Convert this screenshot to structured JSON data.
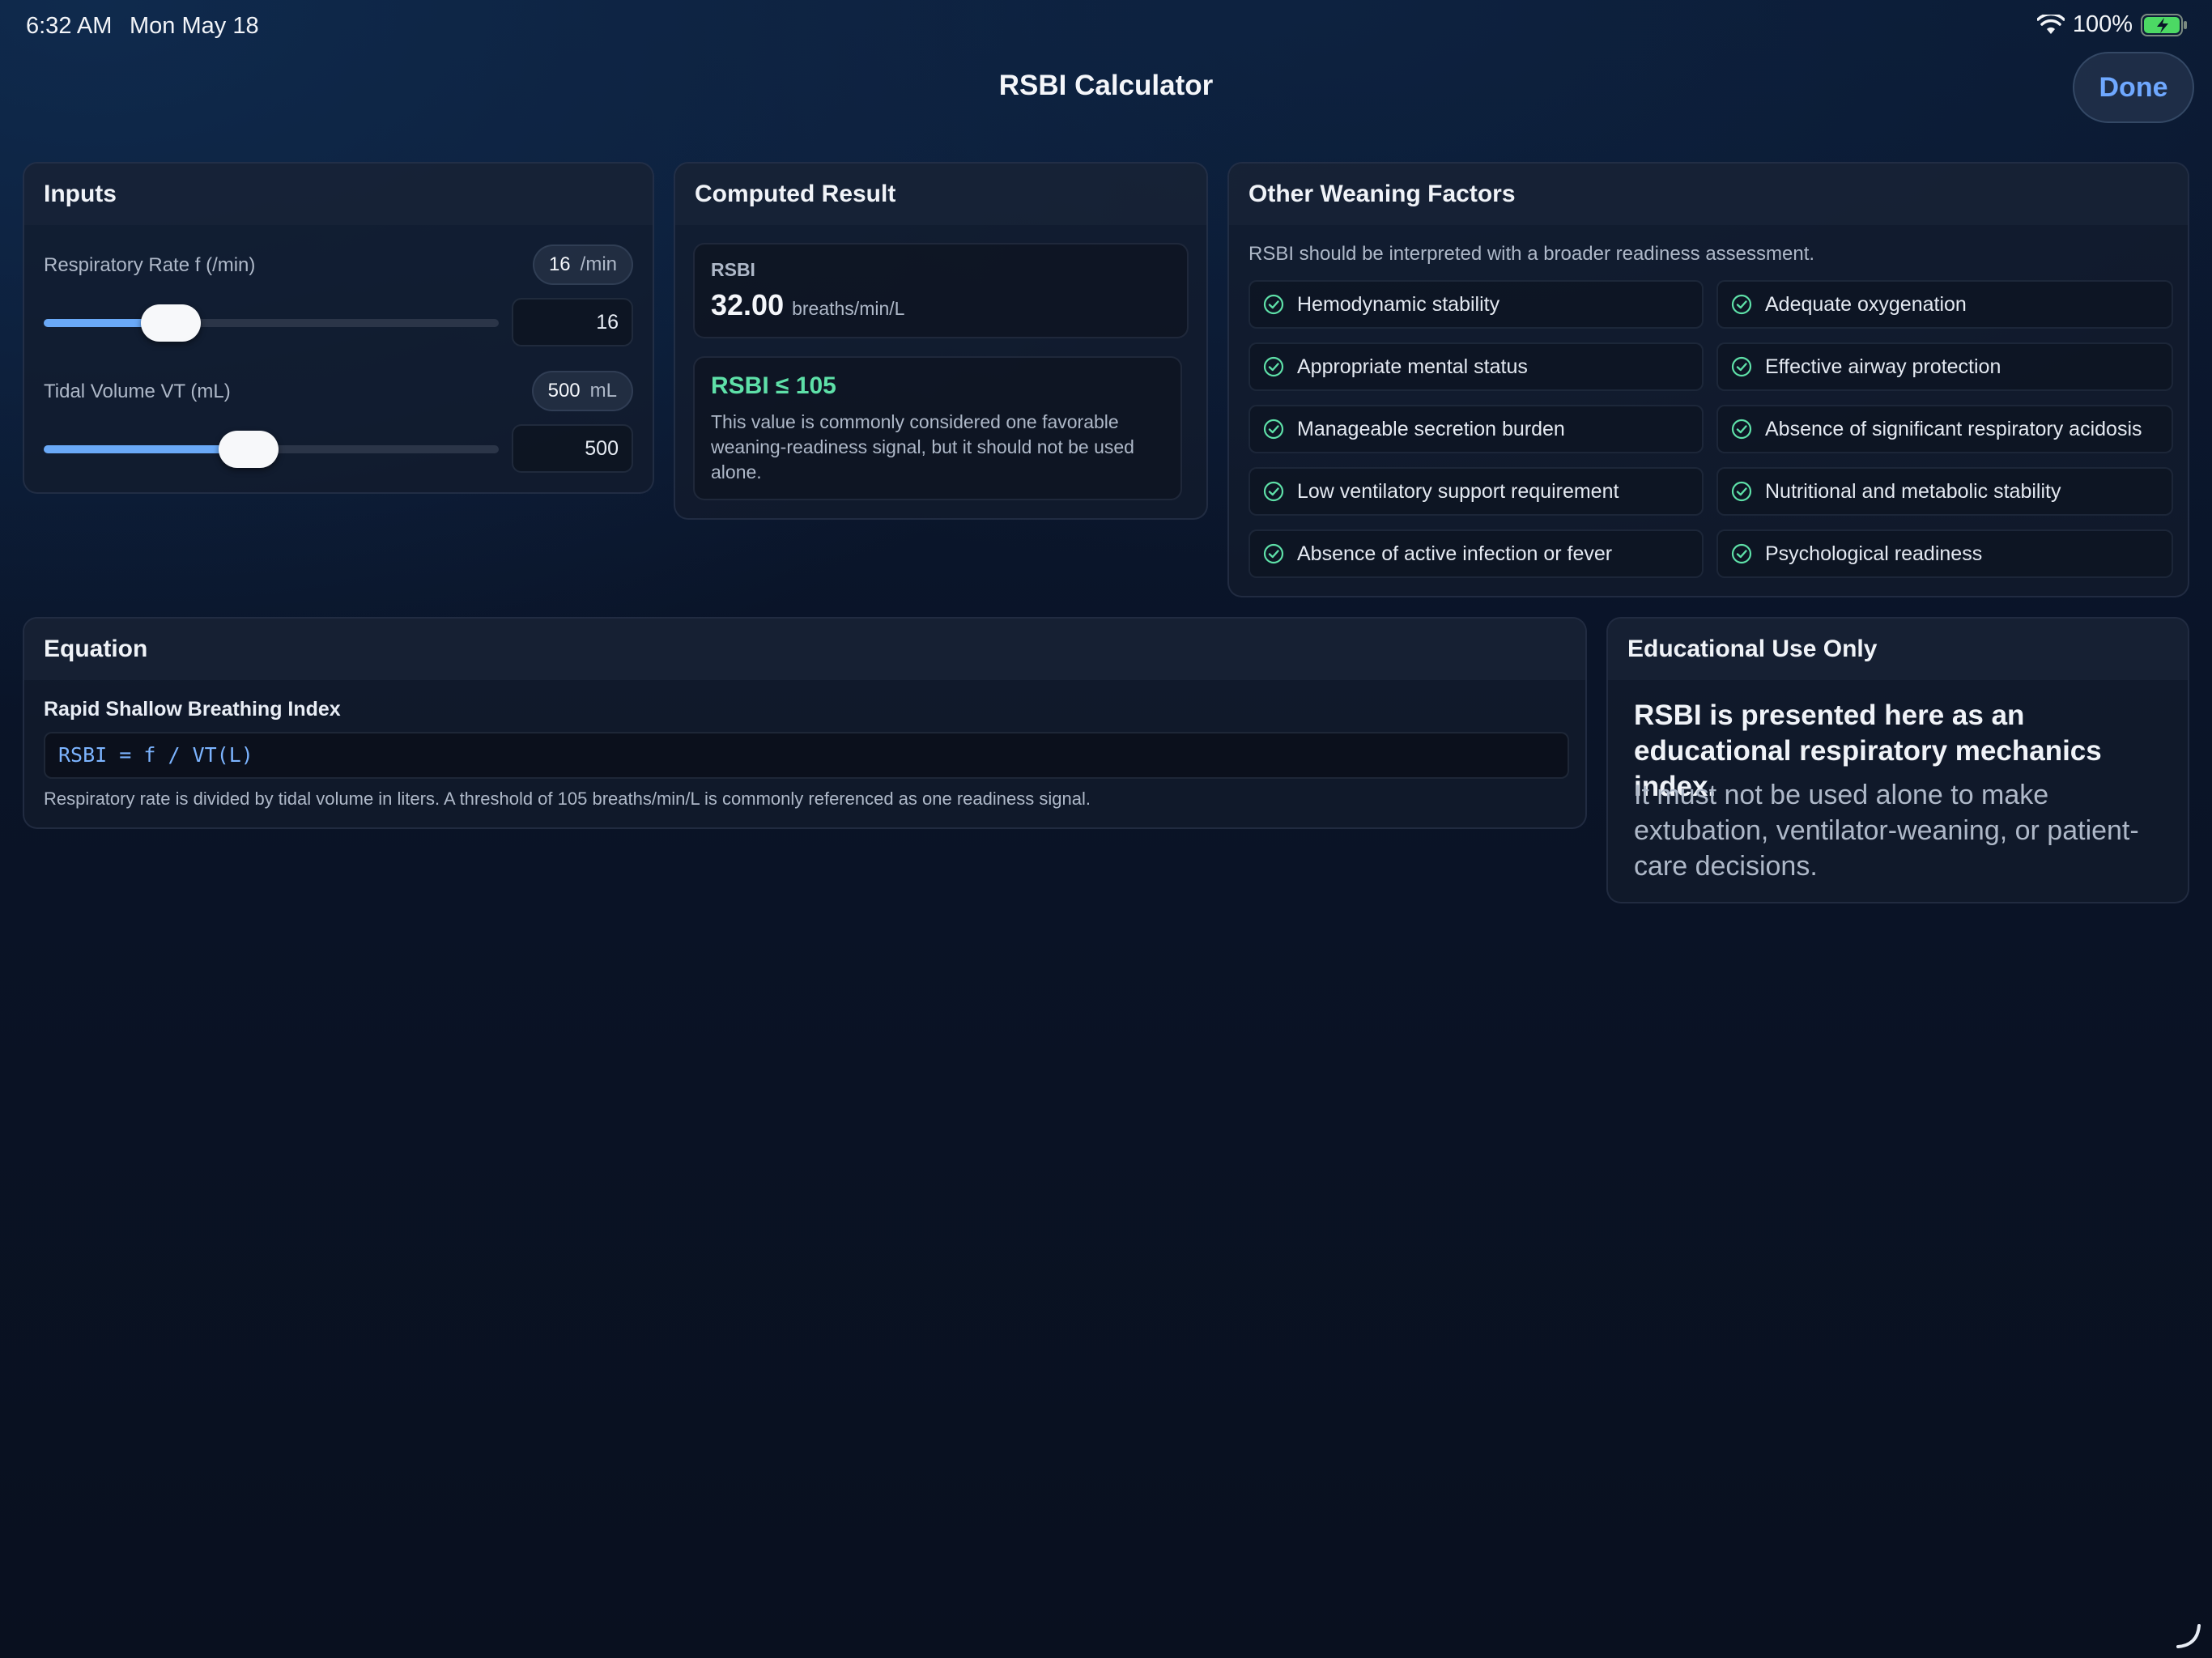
{
  "status": {
    "time": "6:32 AM",
    "date": "Mon May 18",
    "battery": "100%"
  },
  "nav": {
    "title": "RSBI Calculator",
    "done_label": "Done"
  },
  "inputs": {
    "title": "Inputs",
    "resp_rate": {
      "label": "Respiratory Rate f (/min)",
      "value": "16",
      "unit": "/min",
      "field": "16",
      "level": 0.28
    },
    "tidal_volume": {
      "label": "Tidal Volume VT (mL)",
      "value": "500",
      "unit": "mL",
      "field": "500",
      "level": 0.45
    }
  },
  "result": {
    "title": "Computed Result",
    "rsbi_label": "RSBI",
    "rsbi_value": "32.00",
    "rsbi_unit": "breaths/min/L",
    "threshold": "RSBI ≤ 105",
    "note": "This value is commonly considered one favorable weaning-readiness signal, but it should not be used alone."
  },
  "factors": {
    "title": "Other Weaning Factors",
    "intro": "RSBI should be interpreted with a broader readiness assessment.",
    "items": [
      "Hemodynamic stability",
      "Adequate oxygenation",
      "Appropriate mental status",
      "Effective airway protection",
      "Manageable secretion burden",
      "Absence of significant respiratory acidosis",
      "Low ventilatory support requirement",
      "Nutritional and metabolic stability",
      "Absence of active infection or fever",
      "Psychological readiness"
    ]
  },
  "equation": {
    "title": "Equation",
    "subtitle": "Rapid Shallow Breathing Index",
    "formula": "RSBI = f / VT(L)",
    "description": "Respiratory rate is divided by tidal volume in liters. A threshold of 105 breaths/min/L is commonly referenced as one readiness signal."
  },
  "education": {
    "title": "Educational Use Only",
    "headline": "RSBI is presented here as an educational respiratory mechanics index.",
    "body": "It must not be used alone to make extubation, ventilator-weaning, or patient-care decisions."
  },
  "colors": {
    "accent": "#6aa9f7",
    "success": "#5ee0a8",
    "done": "#6fa8ff",
    "battery": "#4cd964"
  }
}
